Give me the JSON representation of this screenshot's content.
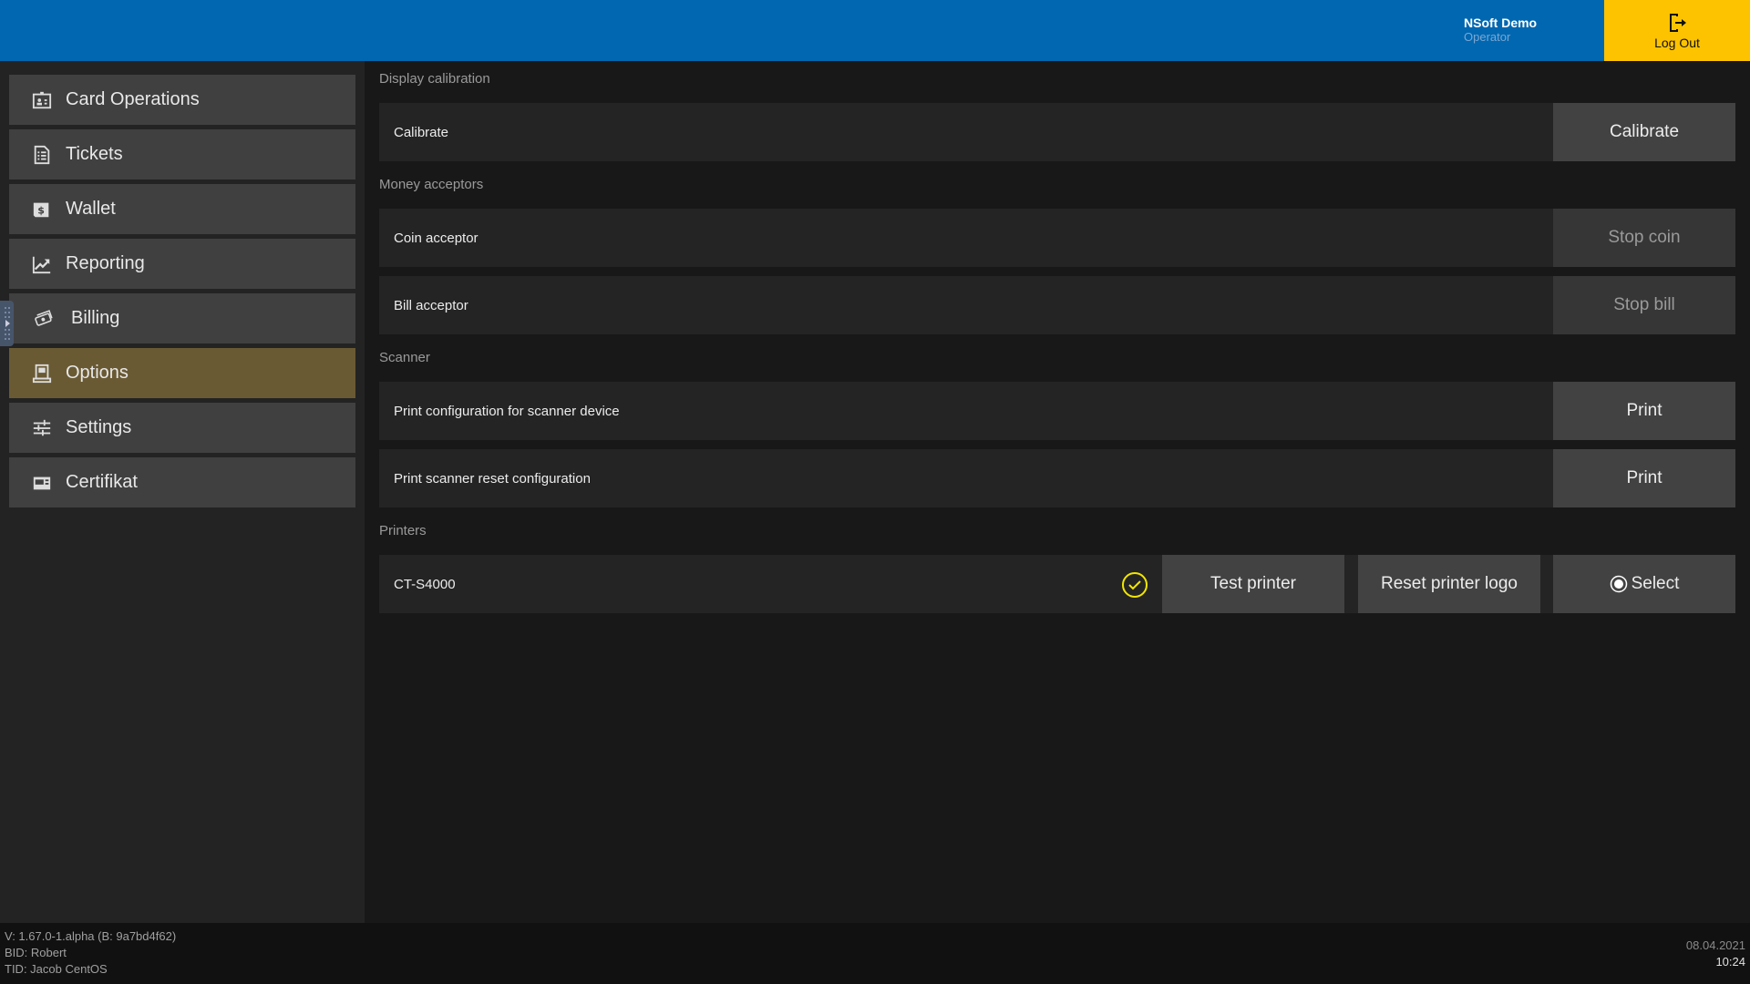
{
  "header": {
    "user_name": "NSoft Demo",
    "user_role": "Operator",
    "logout_label": "Log Out",
    "brand_color": "#0067b0",
    "logout_color": "#fdc300"
  },
  "sidebar": {
    "items": [
      {
        "label": "Card Operations",
        "icon": "id-card-icon",
        "active": false
      },
      {
        "label": "Tickets",
        "icon": "ticket-list-icon",
        "active": false
      },
      {
        "label": "Wallet",
        "icon": "wallet-dollar-icon",
        "active": false
      },
      {
        "label": "Reporting",
        "icon": "chart-trend-icon",
        "active": false
      },
      {
        "label": "Billing",
        "icon": "money-bills-icon",
        "active": false
      },
      {
        "label": "Options",
        "icon": "kiosk-icon",
        "active": true
      },
      {
        "label": "Settings",
        "icon": "sliders-icon",
        "active": false
      },
      {
        "label": "Certifikat",
        "icon": "certificate-icon",
        "active": false
      }
    ],
    "active_color": "#6a5a34"
  },
  "main": {
    "sections": {
      "display_calibration": {
        "title": "Display calibration",
        "rows": [
          {
            "label": "Calibrate",
            "button": "Calibrate",
            "enabled": true
          }
        ]
      },
      "money_acceptors": {
        "title": "Money acceptors",
        "rows": [
          {
            "label": "Coin acceptor",
            "button": "Stop coin",
            "enabled": false
          },
          {
            "label": "Bill acceptor",
            "button": "Stop bill",
            "enabled": false
          }
        ]
      },
      "scanner": {
        "title": "Scanner",
        "rows": [
          {
            "label": "Print configuration for scanner device",
            "button": "Print",
            "enabled": true
          },
          {
            "label": "Print scanner reset configuration",
            "button": "Print",
            "enabled": true
          }
        ]
      },
      "printers": {
        "title": "Printers",
        "rows": [
          {
            "label": "CT-S4000",
            "status": "selected",
            "test_button": "Test printer",
            "reset_button": "Reset printer logo",
            "select_button": "Select"
          }
        ]
      }
    }
  },
  "footer": {
    "version": "V: 1.67.0-1.alpha (B: 9a7bd4f62)",
    "bid": "BID: Robert",
    "tid": "TID: Jacob CentOS",
    "date": "08.04.2021",
    "time": "10:24"
  }
}
